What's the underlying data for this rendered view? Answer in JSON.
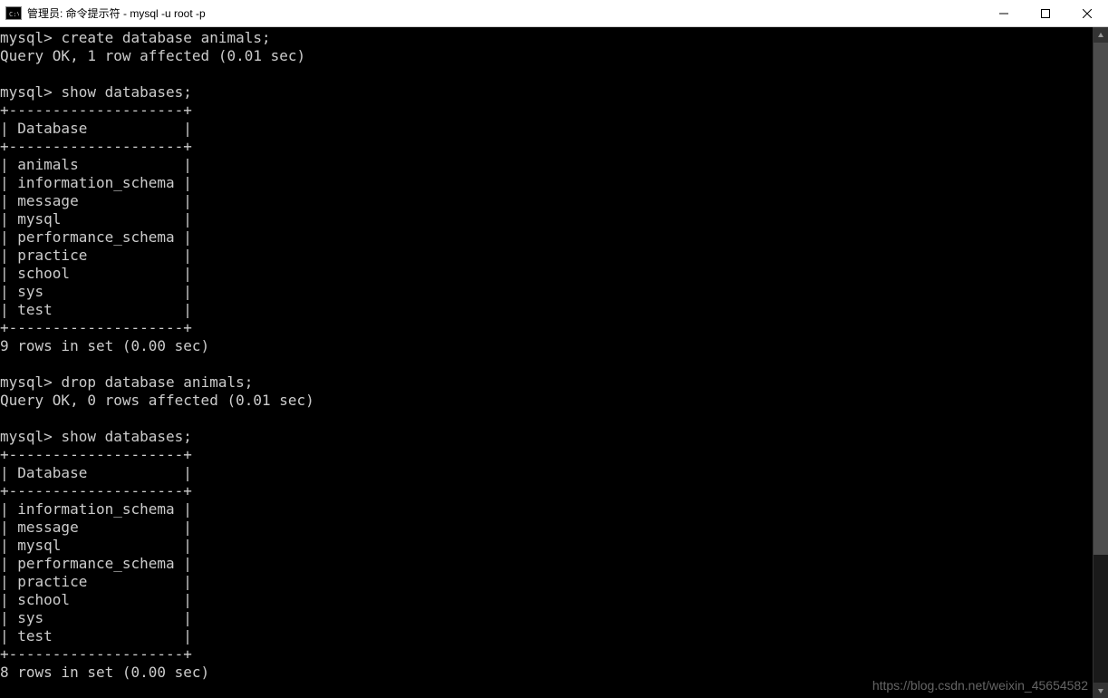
{
  "window": {
    "title": "管理员: 命令提示符 - mysql  -u root -p"
  },
  "terminal": {
    "prompt": "mysql>",
    "cmd1": "create database animals;",
    "result1": "Query OK, 1 row affected (0.01 sec)",
    "cmd2": "show databases;",
    "table1": {
      "header": "Database",
      "rows": [
        "animals",
        "information_schema",
        "message",
        "mysql",
        "performance_schema",
        "practice",
        "school",
        "sys",
        "test"
      ],
      "footer": "9 rows in set (0.00 sec)"
    },
    "cmd3": "drop database animals;",
    "result3": "Query OK, 0 rows affected (0.01 sec)",
    "cmd4": "show databases;",
    "table2": {
      "header": "Database",
      "rows": [
        "information_schema",
        "message",
        "mysql",
        "performance_schema",
        "practice",
        "school",
        "sys",
        "test"
      ],
      "footer": "8 rows in set (0.00 sec)"
    }
  },
  "watermark": "https://blog.csdn.net/weixin_45654582"
}
